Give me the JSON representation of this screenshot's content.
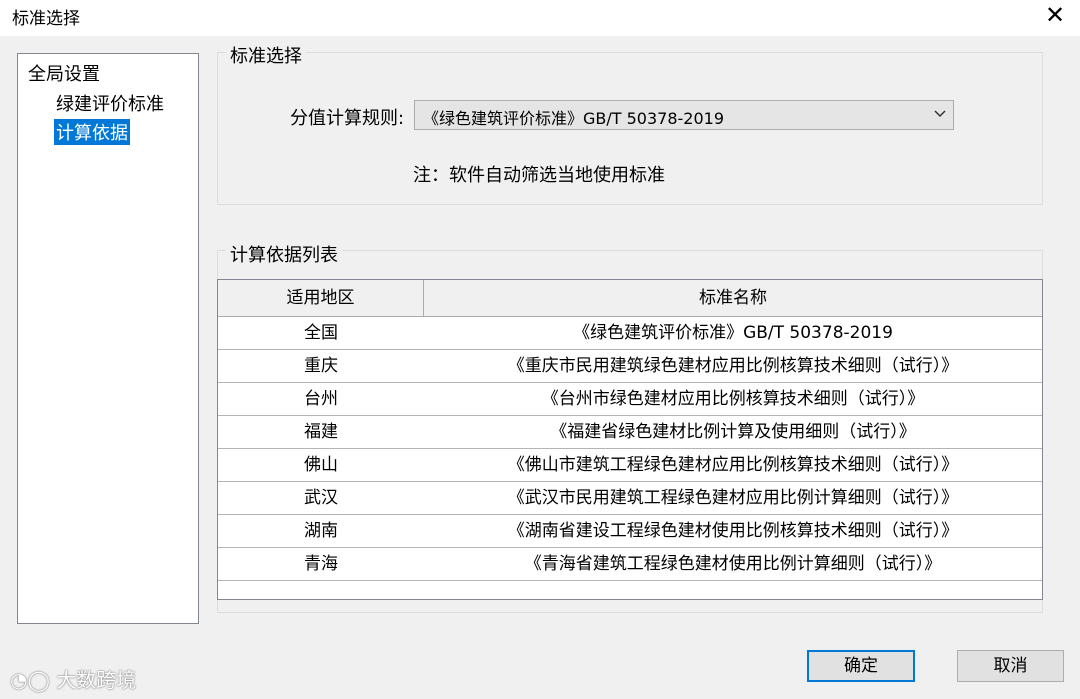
{
  "window": {
    "title": "标准选择",
    "close_glyph": "✕"
  },
  "tree": {
    "root": "全局设置",
    "children": [
      "绿建评价标准",
      "计算依据"
    ],
    "selected": "计算依据"
  },
  "standard_group": {
    "legend": "标准选择",
    "field_label": "分值计算规则:",
    "selected_value": "《绿色建筑评价标准》GB/T 50378-2019",
    "note": "注：软件自动筛选当地使用标准"
  },
  "list_group": {
    "legend": "计算依据列表",
    "columns": [
      "适用地区",
      "标准名称"
    ],
    "rows": [
      {
        "region": "全国",
        "name": "《绿色建筑评价标准》GB/T 50378-2019"
      },
      {
        "region": "重庆",
        "name": "《重庆市民用建筑绿色建材应用比例核算技术细则（试行）》"
      },
      {
        "region": "台州",
        "name": "《台州市绿色建材应用比例核算技术细则（试行）》"
      },
      {
        "region": "福建",
        "name": "《福建省绿色建材比例计算及使用细则（试行）》"
      },
      {
        "region": "佛山",
        "name": "《佛山市建筑工程绿色建材应用比例核算技术细则（试行）》"
      },
      {
        "region": "武汉",
        "name": "《武汉市民用建筑工程绿色建材应用比例计算细则（试行）》"
      },
      {
        "region": "湖南",
        "name": "《湖南省建设工程绿色建材使用比例核算技术细则（试行）》"
      },
      {
        "region": "青海",
        "name": "《青海省建筑工程绿色建材使用比例计算细则（试行）》"
      }
    ]
  },
  "buttons": {
    "ok": "确定",
    "cancel": "取消"
  },
  "watermark": "大数跨境",
  "icons": {
    "close": "close-icon",
    "dropdown": "chevron-down-icon"
  }
}
